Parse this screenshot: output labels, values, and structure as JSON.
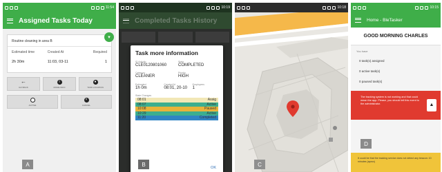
{
  "panelA": {
    "status_time": "11:54",
    "title": "Assigned Tasks Today",
    "task_name": "Routine cleaning in area B",
    "columns": [
      "Estimated time",
      "Created At",
      "Required"
    ],
    "values": [
      "2h 30m",
      "11:03, 03-11",
      "1"
    ],
    "actions": [
      {
        "icon": "arrow-left-icon",
        "label": "GO BACK"
      },
      {
        "icon": "info-icon",
        "label": "MORE INFO"
      },
      {
        "icon": "pin-icon",
        "label": "TASK LOCATION"
      },
      {
        "icon": "check-circle-icon",
        "label": "ACTIVE"
      },
      {
        "icon": "cancel-icon",
        "label": "CANCEL"
      }
    ],
    "letter": "A"
  },
  "panelB": {
    "status_time": "10:19",
    "title": "Completed Tasks History",
    "dialog_title": "Task more information",
    "id_label": "ID Activity",
    "id_value": "CLE0120801060",
    "state_label": "State",
    "state_value": "COMPLETED",
    "category_label": "Category",
    "category_value": "CLEANER",
    "priority_label": "Priority",
    "priority_value": "HIGH",
    "estimated_label": "Estimated",
    "estimated_value": "1h 0m",
    "created_label": "Created At",
    "created_value": "08:01, 20-10",
    "employees_label": "Employees",
    "employees_value": "1",
    "state_changes_label": "State Changes",
    "state_changes": [
      {
        "time": "08:01",
        "state": "Assig",
        "color": "#f2e7b6"
      },
      {
        "time": "08:07",
        "state": "Active",
        "color": "#3cae8f"
      },
      {
        "time": "10:08",
        "state": "Paused",
        "color": "#e8b33a"
      },
      {
        "time": "10:29",
        "state": "Active",
        "color": "#3cae8f"
      },
      {
        "time": "11:20",
        "state": "Completed",
        "color": "#2f84c4"
      }
    ],
    "ok_label": "OK",
    "letter": "B"
  },
  "panelC": {
    "status_time": "10:18",
    "marker_color": "#e03a2f",
    "letter": "C"
  },
  "panelD": {
    "status_time": "10:15",
    "title": "Home - BleTasker",
    "greeting": "GOOD MORNING CHARLES",
    "you_have": "You have",
    "lines": [
      "0 task(s) assigned",
      "0 active task(s)",
      "0 paused task(s)"
    ],
    "warning": "The tracking system is not working and that could mean the app. Please, you should tell this event to the administrator.",
    "notice": "It could be that the tracking service does not detect any beacon: 10 minutes (aprox)",
    "letter": "D"
  }
}
